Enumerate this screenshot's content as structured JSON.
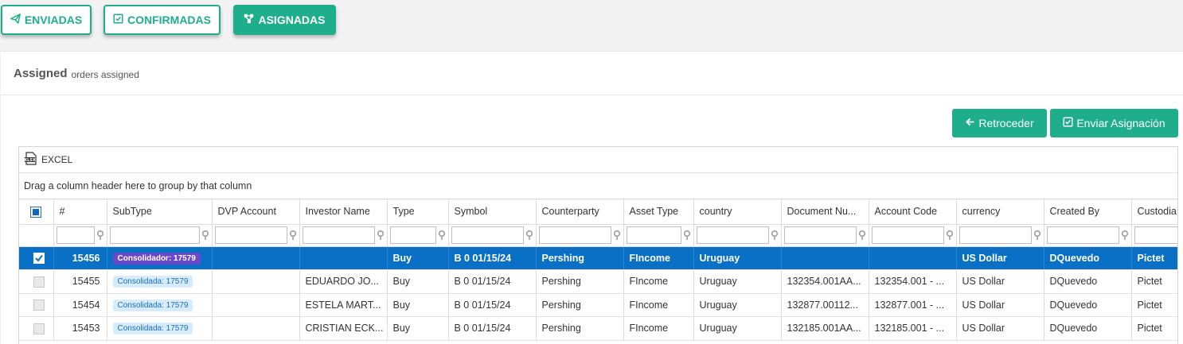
{
  "tabs": [
    {
      "label": "ENVIADAS",
      "icon": "paper-plane-icon"
    },
    {
      "label": "CONFIRMADAS",
      "icon": "check-square-icon"
    },
    {
      "label": "ASIGNADAS",
      "icon": "sitemap-icon"
    }
  ],
  "panel": {
    "title": "Assigned",
    "subtitle": "orders assigned"
  },
  "actions": {
    "back_label": "Retroceder",
    "send_label": "Enviar Asignación"
  },
  "grid": {
    "excel_label": "EXCEL",
    "group_hint": "Drag a column header here to group by that column",
    "columns": [
      "#",
      "SubType",
      "DVP Account",
      "Investor Name",
      "Type",
      "Symbol",
      "Counterparty",
      "Asset Type",
      "country",
      "Document Nu...",
      "Account Code",
      "currency",
      "Created By",
      "Custodia"
    ],
    "rows": [
      {
        "selected": true,
        "id": "15456",
        "subtype": "Consolidador: 17579",
        "dvp": "",
        "investor": "",
        "type": "Buy",
        "symbol": "B 0 01/15/24",
        "counterparty": "Pershing",
        "asset_type": "FIncome",
        "country": "Uruguay",
        "document": "",
        "account": "",
        "currency": "US Dollar",
        "created_by": "DQuevedo",
        "custodian": "Pictet"
      },
      {
        "selected": false,
        "id": "15455",
        "subtype": "Consolidada: 17579",
        "dvp": "",
        "investor": "EDUARDO JO...",
        "type": "Buy",
        "symbol": "B 0 01/15/24",
        "counterparty": "Pershing",
        "asset_type": "FIncome",
        "country": "Uruguay",
        "document": "132354.001AA...",
        "account": "132354.001 - ...",
        "currency": "US Dollar",
        "created_by": "DQuevedo",
        "custodian": "Pictet"
      },
      {
        "selected": false,
        "id": "15454",
        "subtype": "Consolidada: 17579",
        "dvp": "",
        "investor": "ESTELA MART...",
        "type": "Buy",
        "symbol": "B 0 01/15/24",
        "counterparty": "Pershing",
        "asset_type": "FIncome",
        "country": "Uruguay",
        "document": "132877.00112...",
        "account": "132877.001 - ...",
        "currency": "US Dollar",
        "created_by": "DQuevedo",
        "custodian": "Pictet"
      },
      {
        "selected": false,
        "id": "15453",
        "subtype": "Consolidada: 17579",
        "dvp": "",
        "investor": "CRISTIAN ECK...",
        "type": "Buy",
        "symbol": "B 0 01/15/24",
        "counterparty": "Pershing",
        "asset_type": "FIncome",
        "country": "Uruguay",
        "document": "132185.001AA...",
        "account": "132185.001 - ...",
        "currency": "US Dollar",
        "created_by": "DQuevedo",
        "custodian": "Pictet"
      }
    ]
  },
  "colors": {
    "accent": "#1fae8c",
    "selection": "#0a70c5",
    "badge_primary": "#6a48c9",
    "badge_secondary": "#d6ebfb"
  }
}
